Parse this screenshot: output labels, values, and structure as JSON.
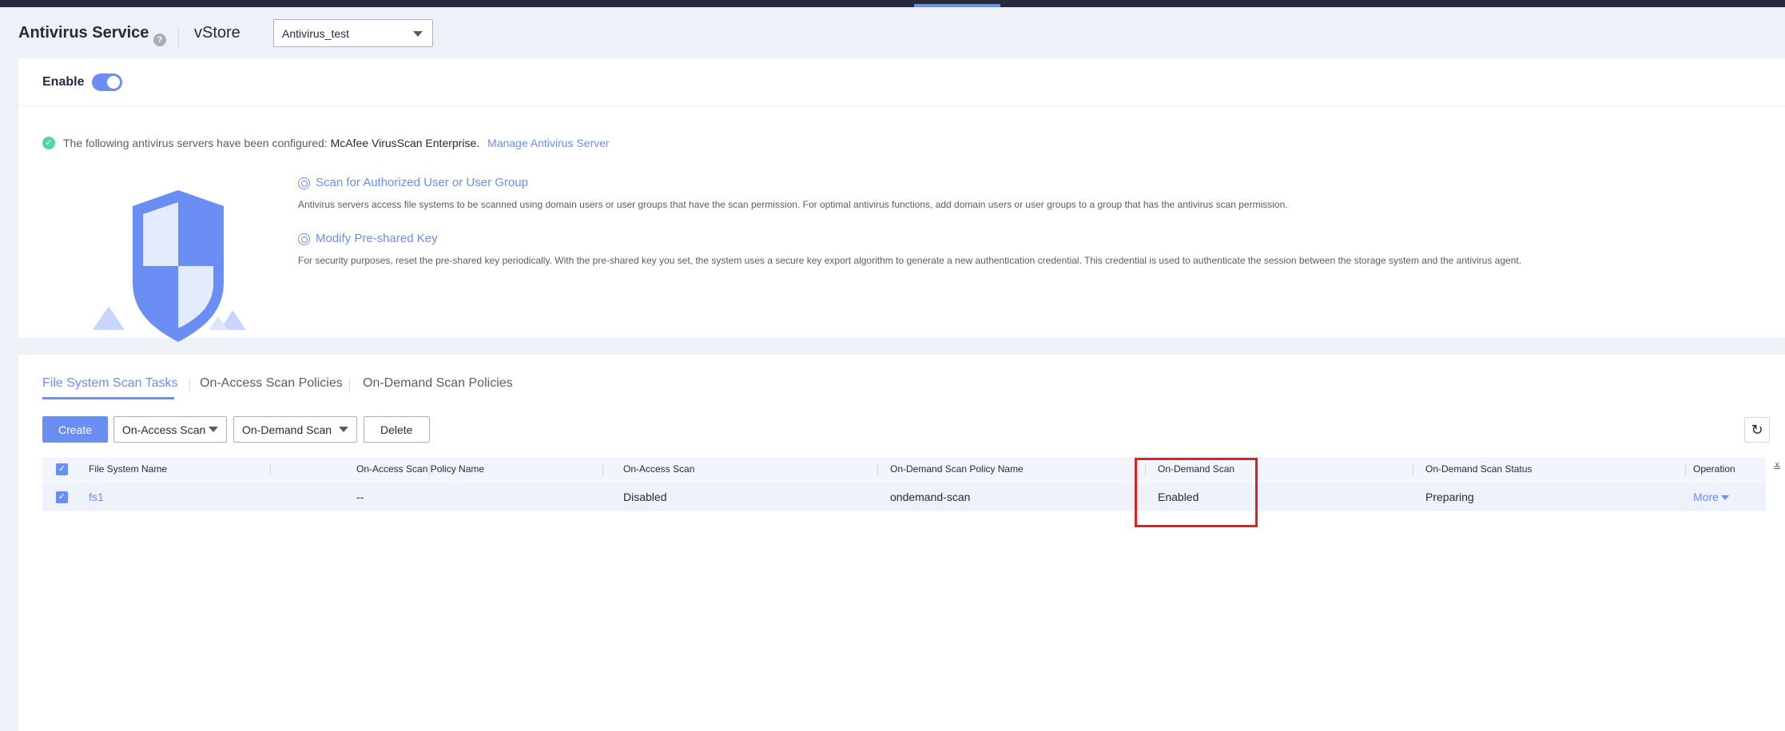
{
  "header": {
    "title": "Antivirus Service",
    "help_icon": "question-circle-icon",
    "vstore_label": "vStore",
    "vstore_value": "Antivirus_test"
  },
  "enable": {
    "label": "Enable",
    "state": "on"
  },
  "server_info": {
    "prefix": "The following antivirus servers have been configured:",
    "server_name": "McAfee VirusScan Enterprise.",
    "manage_link": "Manage Antivirus Server"
  },
  "hints": [
    {
      "title": "Scan for Authorized User or User Group",
      "desc": "Antivirus servers access file systems to be scanned using domain users or user groups that have the scan permission. For optimal antivirus functions, add domain users or user groups to a group that has the antivirus scan permission."
    },
    {
      "title": "Modify Pre-shared Key",
      "desc": "For security purposes, reset the pre-shared key periodically. With the pre-shared key you set, the system uses a secure key export algorithm to generate a new authentication credential. This credential is used to authenticate the session between the storage system and the antivirus agent."
    }
  ],
  "tabs": [
    {
      "label": "File System Scan Tasks",
      "active": true
    },
    {
      "label": "On-Access Scan Policies",
      "active": false
    },
    {
      "label": "On-Demand Scan Policies",
      "active": false
    }
  ],
  "toolbar": {
    "create": "Create",
    "on_access": "On-Access Scan",
    "on_demand": "On-Demand Scan",
    "delete": "Delete",
    "refresh_icon": "refresh-icon"
  },
  "table": {
    "columns": [
      "File System Name",
      "On-Access Scan Policy Name",
      "On-Access Scan",
      "On-Demand Scan Policy Name",
      "On-Demand Scan",
      "On-Demand Scan Status",
      "Operation"
    ],
    "rows": [
      {
        "name": "fs1",
        "on_access_policy": "--",
        "on_access_scan": "Disabled",
        "on_demand_policy": "ondemand-scan",
        "on_demand_scan": "Enabled",
        "status": "Preparing",
        "operation": "More"
      }
    ]
  },
  "colors": {
    "accent": "#6b8ef5",
    "success": "#50d4ab",
    "highlight": "#e02020"
  }
}
